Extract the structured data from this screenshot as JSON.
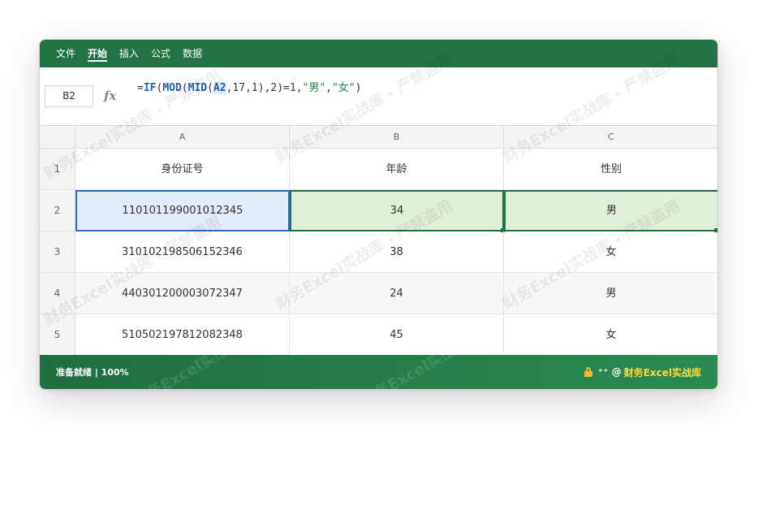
{
  "menu": [
    "文件",
    "开始",
    "插入",
    "公式",
    "数据"
  ],
  "active_menu_index": 1,
  "name_box": "B2",
  "fx_label": "fx",
  "formula": {
    "eq": "=",
    "fn_if": "IF",
    "p1": "(",
    "fn_mod": "MOD",
    "p2": "(",
    "fn_mid": "MID",
    "p3": "(",
    "ref": "A2",
    "args": ",17,1),2)=1,",
    "str_male": "\"男\"",
    "comma": ",",
    "str_female": "\"女\"",
    "close": ")"
  },
  "columns": [
    "A",
    "B",
    "C"
  ],
  "row_numbers": [
    "1",
    "2",
    "3",
    "4",
    "5"
  ],
  "headers": [
    "身份证号",
    "年龄",
    "性别"
  ],
  "rows": [
    [
      "110101199001012345",
      "34",
      "男"
    ],
    [
      "310102198506152346",
      "38",
      "女"
    ],
    [
      "440301200003072347",
      "24",
      "男"
    ],
    [
      "510502197812082348",
      "45",
      "女"
    ]
  ],
  "status": {
    "left": "准备就绪 | 100%",
    "mid_glyph": "⁺⁺ @",
    "brand": "财务Excel实战库"
  },
  "watermark_text": "财务Excel实战库 - 严禁盗用",
  "colors": {
    "excel_green": "#217346",
    "selection_blue": "#2f6fc4",
    "brand_yellow": "#ffd93b"
  }
}
